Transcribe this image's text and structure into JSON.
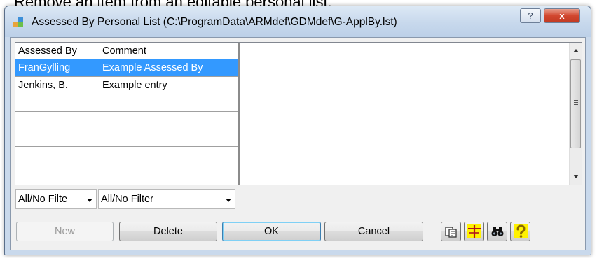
{
  "caption": "Remove an item from an editable personal list.",
  "window": {
    "title": "Assessed By Personal List (C:\\ProgramData\\ARMdef\\GDMdef\\G-ApplBy.lst)",
    "help_glyph": "?",
    "close_glyph": "x"
  },
  "grid": {
    "columns": [
      "Assessed By",
      "Comment"
    ],
    "rows": [
      {
        "assessed_by": "FranGylling",
        "comment": "Example Assessed By",
        "selected": true
      },
      {
        "assessed_by": "Jenkins, B.",
        "comment": "Example entry",
        "selected": false
      },
      {
        "assessed_by": "",
        "comment": ""
      },
      {
        "assessed_by": "",
        "comment": ""
      },
      {
        "assessed_by": "",
        "comment": ""
      },
      {
        "assessed_by": "",
        "comment": ""
      }
    ]
  },
  "filters": {
    "filter1": "All/No Filte",
    "filter2": "All/No Filter"
  },
  "buttons": {
    "new": "New",
    "delete": "Delete",
    "ok": "OK",
    "cancel": "Cancel"
  },
  "icons": [
    "copy-icon",
    "column-sizer-icon",
    "binoculars-icon",
    "help-icon"
  ],
  "colors": {
    "selection": "#3399ff",
    "title_bar": "#c9d9ec",
    "close_button": "#c13a22"
  }
}
